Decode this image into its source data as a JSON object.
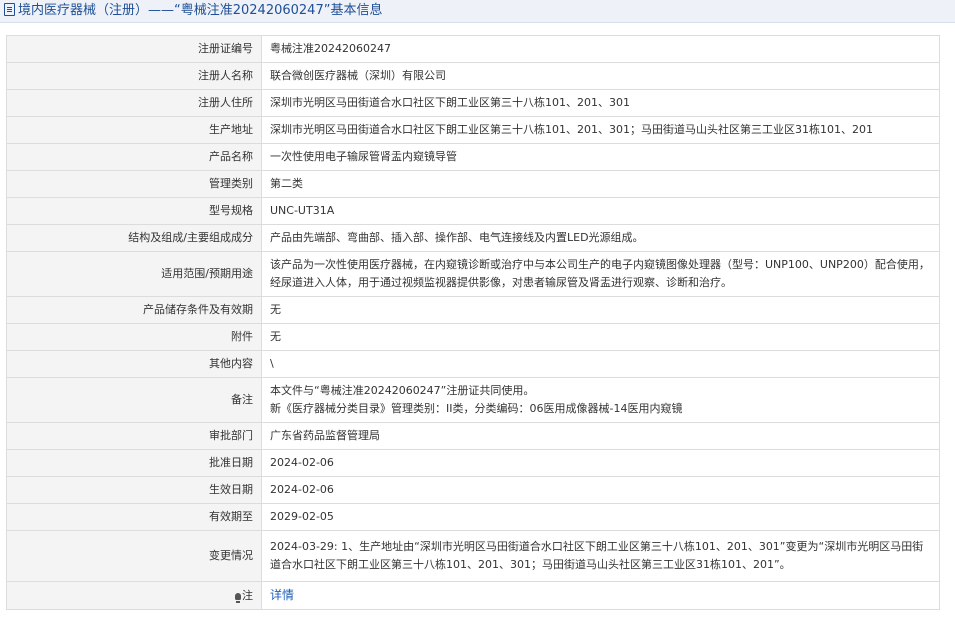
{
  "header": {
    "title": "境内医疗器械（注册）——“粤械注准20242060247”基本信息"
  },
  "rows": [
    {
      "label": "注册证编号",
      "value": "粤械注准20242060247"
    },
    {
      "label": "注册人名称",
      "value": "联合微创医疗器械（深圳）有限公司"
    },
    {
      "label": "注册人住所",
      "value": "深圳市光明区马田街道合水口社区下朗工业区第三十八栋101、201、301"
    },
    {
      "label": "生产地址",
      "value": "深圳市光明区马田街道合水口社区下朗工业区第三十八栋101、201、301；马田街道马山头社区第三工业区31栋101、201"
    },
    {
      "label": "产品名称",
      "value": "一次性使用电子输尿管肾盂内窥镜导管"
    },
    {
      "label": "管理类别",
      "value": "第二类"
    },
    {
      "label": "型号规格",
      "value": "UNC-UT31A"
    },
    {
      "label": "结构及组成/主要组成成分",
      "value": "产品由先端部、弯曲部、插入部、操作部、电气连接线及内置LED光源组成。"
    },
    {
      "label": "适用范围/预期用途",
      "value": "该产品为一次性使用医疗器械，在内窥镜诊断或治疗中与本公司生产的电子内窥镜图像处理器（型号：UNP100、UNP200）配合使用，经尿道进入人体，用于通过视频监视器提供影像，对患者输尿管及肾盂进行观察、诊断和治疗。"
    },
    {
      "label": "产品储存条件及有效期",
      "value": "无"
    },
    {
      "label": "附件",
      "value": "无"
    },
    {
      "label": "其他内容",
      "value": "\\"
    },
    {
      "label": "备注",
      "value_line1": "本文件与“粤械注准20242060247”注册证共同使用。",
      "value_line2": "新《医疗器械分类目录》管理类别：II类，分类编码：06医用成像器械-14医用内窥镜"
    },
    {
      "label": "审批部门",
      "value": "广东省药品监督管理局"
    },
    {
      "label": "批准日期",
      "value": "2024-02-06"
    },
    {
      "label": "生效日期",
      "value": "2024-02-06"
    },
    {
      "label": "有效期至",
      "value": "2029-02-05"
    },
    {
      "label": "变更情况",
      "value": "2024-03-29: 1、生产地址由“深圳市光明区马田街道合水口社区下朗工业区第三十八栋101、201、301”变更为“深圳市光明区马田街道合水口社区下朗工业区第三十八栋101、201、301；马田街道马山头社区第三工业区31栋101、201”。"
    }
  ],
  "note": {
    "label": "注",
    "icon": "bulb-icon",
    "link": "详情"
  }
}
